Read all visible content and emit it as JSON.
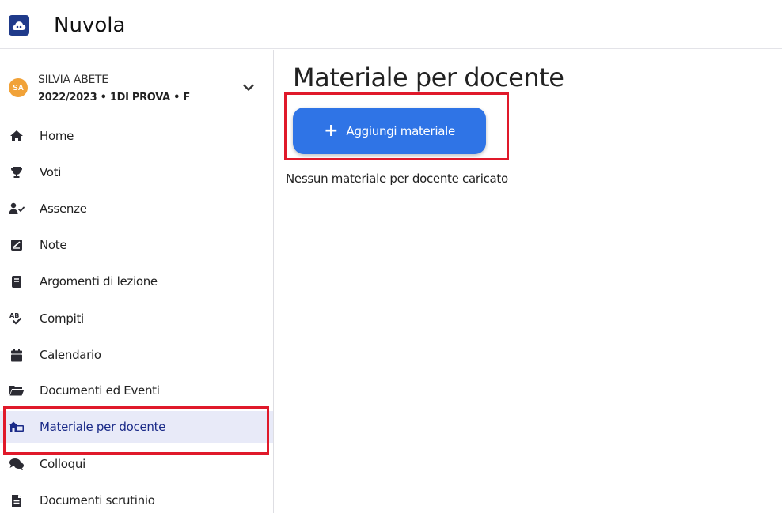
{
  "app": {
    "title": "Nuvola"
  },
  "user": {
    "initials": "SA",
    "name": "SILVIA ABETE",
    "class_info": "2022/2023 • 1DI PROVA • F"
  },
  "sidebar": {
    "items": [
      {
        "label": "Home",
        "icon": "home-icon",
        "active": false
      },
      {
        "label": "Voti",
        "icon": "trophy-icon",
        "active": false
      },
      {
        "label": "Assenze",
        "icon": "user-check-icon",
        "active": false
      },
      {
        "label": "Note",
        "icon": "note-icon",
        "active": false
      },
      {
        "label": "Argomenti di lezione",
        "icon": "book-icon",
        "active": false
      },
      {
        "label": "Compiti",
        "icon": "spellcheck-icon",
        "active": false
      },
      {
        "label": "Calendario",
        "icon": "calendar-icon",
        "active": false
      },
      {
        "label": "Documenti ed Eventi",
        "icon": "folder-open-icon",
        "active": false
      },
      {
        "label": "Materiale per docente",
        "icon": "teacher-material-icon",
        "active": true
      },
      {
        "label": "Colloqui",
        "icon": "chat-icon",
        "active": false
      },
      {
        "label": "Documenti scrutinio",
        "icon": "document-icon",
        "active": false
      }
    ]
  },
  "main": {
    "title": "Materiale per docente",
    "add_button_label": "Aggiungi materiale",
    "empty_message": "Nessun materiale per docente caricato"
  },
  "colors": {
    "primary": "#2f74e6",
    "brand_dark": "#1f3a8a",
    "avatar": "#f1a238",
    "active_bg": "#e8eaf8",
    "highlight": "#e0192a"
  }
}
